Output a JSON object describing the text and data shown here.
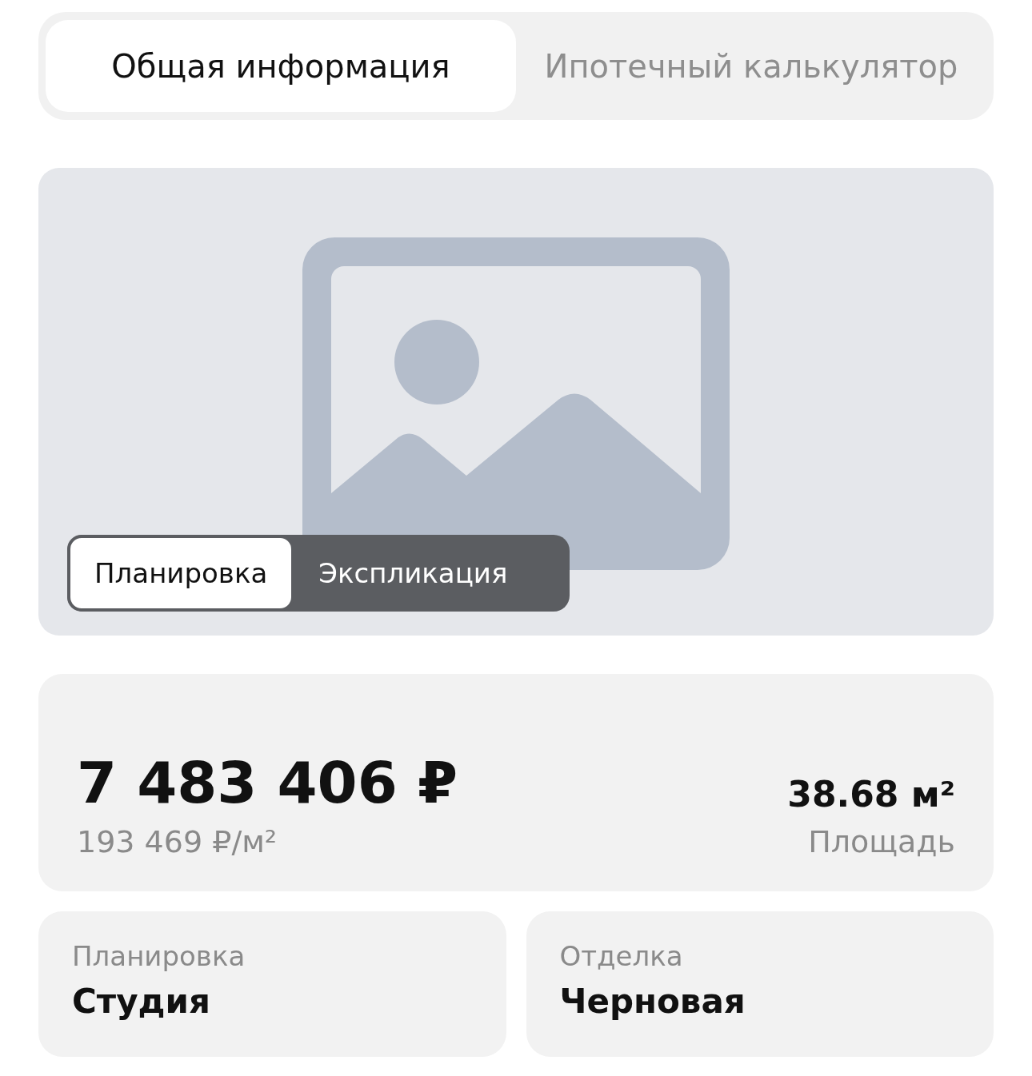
{
  "tabs": [
    {
      "label": "Общая информация",
      "selected": true
    },
    {
      "label": "Ипотечный калькулятор",
      "selected": false
    }
  ],
  "plan_view": {
    "switch": [
      {
        "label": "Планировка",
        "selected": true
      },
      {
        "label": "Экспликация",
        "selected": false
      }
    ]
  },
  "price_card": {
    "price": "7 483 406 ₽",
    "price_per_m2": "193 469 ₽/м²",
    "area": "38.68 м²",
    "area_label": "Площадь"
  },
  "details": [
    {
      "label": "Планировка",
      "value": "Студия"
    },
    {
      "label": "Отделка",
      "value": "Черновая"
    }
  ]
}
